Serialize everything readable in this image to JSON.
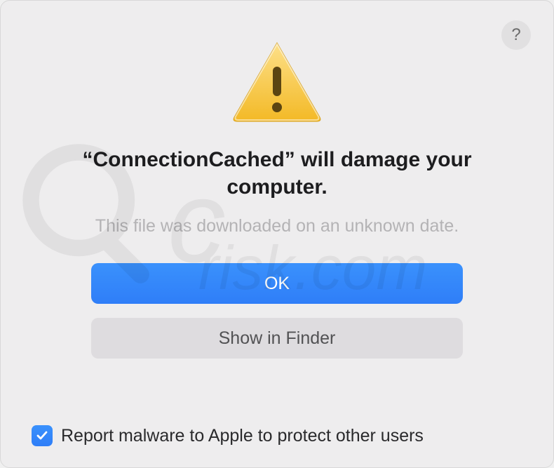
{
  "dialog": {
    "headline": "“ConnectionCached” will damage your computer.",
    "subtext": "This file was downloaded on an unknown date.",
    "buttons": {
      "primary_label": "OK",
      "secondary_label": "Show in Finder"
    },
    "checkbox": {
      "label": "Report malware to Apple to protect other users",
      "checked": true
    },
    "help_label": "?"
  }
}
